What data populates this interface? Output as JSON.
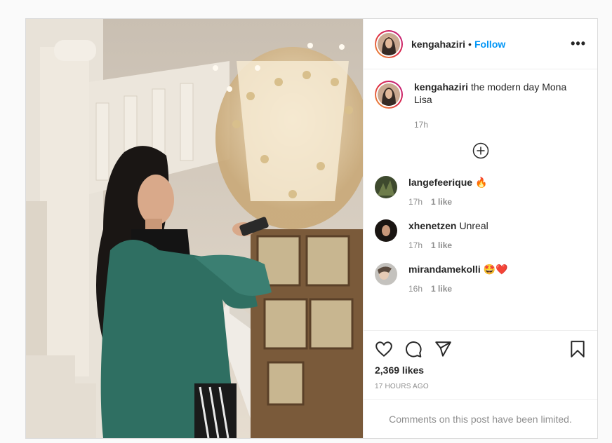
{
  "post": {
    "username": "kengahaziri",
    "separator": "•",
    "follow_label": "Follow",
    "more_label": "•••",
    "caption": {
      "username": "kengahaziri",
      "text": "the modern day Mona Lisa",
      "time": "17h"
    },
    "comments": [
      {
        "username": "langefeerique",
        "text": "🔥",
        "time": "17h",
        "likes": "1 like",
        "avatar_color": "#4a5a3a"
      },
      {
        "username": "xhenetzen",
        "text": "Unreal",
        "time": "17h",
        "likes": "1 like",
        "avatar_color": "#2a2420"
      },
      {
        "username": "mirandamekolli",
        "text": "🤩❤️",
        "time": "16h",
        "likes": "1 like",
        "avatar_color": "#b8b6b2"
      }
    ],
    "like_count": "2,369 likes",
    "posted": "17 HOURS AGO",
    "comments_notice": "Comments on this post have been limited.",
    "icons": [
      "heart-icon",
      "comment-icon",
      "share-icon",
      "bookmark-icon",
      "plus-circle-icon"
    ],
    "colors": {
      "follow": "#0095f6",
      "muted": "#8e8e8e",
      "text": "#262626"
    }
  }
}
